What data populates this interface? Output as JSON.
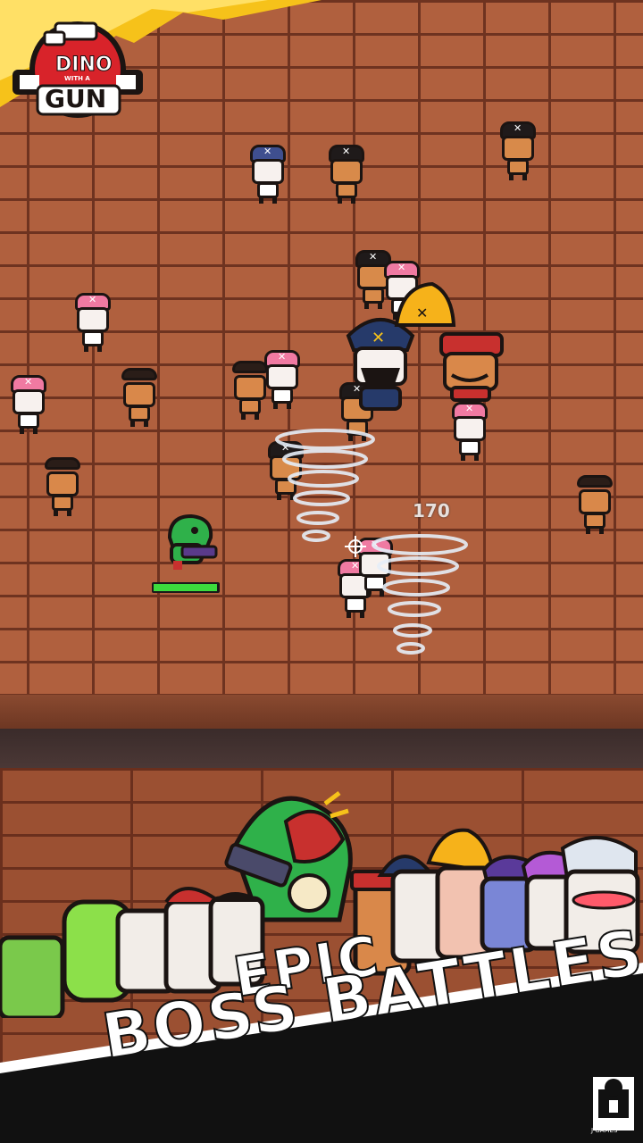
{
  "logo": {
    "line1": "DINO",
    "small": "WITH A",
    "line2": "GUN"
  },
  "hud": {
    "damage_number": "170",
    "player_health": 0.98
  },
  "banner": {
    "line1": "EPIC",
    "line2": "BOSS BATTLES"
  },
  "publisher": {
    "name": "J GAMES",
    "sub": "ENTERTAINMENT"
  },
  "colors": {
    "brick": "#b0603e",
    "mortar": "#6e3320",
    "health": "#3ddc3d",
    "logo_red": "#d8232a",
    "banner_text": "#ffffff"
  },
  "icons": [
    "dino-player-icon",
    "pirate-enemy-icon",
    "pirate-captain-boss-icon",
    "tornado-effect-icon",
    "crosshair-icon",
    "publisher-logo-icon"
  ]
}
